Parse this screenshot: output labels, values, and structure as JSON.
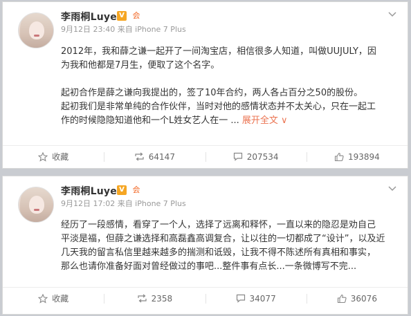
{
  "posts": [
    {
      "username": "李雨桐Luyee",
      "verified_label": "V",
      "member_label": "会",
      "meta": "9月12日 23:40 来自 iPhone 7 Plus",
      "menu_icon": "chevron-down-icon",
      "lines": [
        "2012年，我和薛之谦一起开了一间淘宝店，相信很多人知道，叫做UUJULY，因",
        "为我和他都是7月生，便取了这个名字。",
        "",
        "起初合作是薛之谦向我提出的，签了10年合约，两人各占百分之50的股份。",
        "起初我们是非常单纯的合作伙伴，当时对他的感情状态并不太关心，只在一起工",
        "作的时候隐隐知道他和一个L姓女艺人在一 ..."
      ],
      "expand_label": "展开全文 ∨",
      "actions": {
        "favorite": "收藏",
        "repost": "64147",
        "comment": "207534",
        "like": "193894"
      }
    },
    {
      "username": "李雨桐Luyee",
      "verified_label": "V",
      "member_label": "会",
      "meta": "9月12日 17:02 来自 iPhone 7 Plus",
      "menu_icon": "chevron-down-icon",
      "lines": [
        "经历了一段感情，看穿了一个人，选择了远离和释怀，一直以来的隐忍是劝自己",
        "平淡是福，但薛之谦选择和高磊鑫高调复合，让以往的一切都成了“设计”，以及近",
        "几天我的留言私信里越来越多的揣测和诋毁，让我不得不陈述所有真相和事实，",
        "那么也请你准备好面对曾经做过的事吧...整件事有点长...一条微博写不完..."
      ],
      "actions": {
        "favorite": "收藏",
        "repost": "2358",
        "comment": "34077",
        "like": "36076"
      }
    }
  ],
  "colors": {
    "expand": "#eb7350",
    "verified": "#f5a623",
    "meta": "#999999"
  }
}
